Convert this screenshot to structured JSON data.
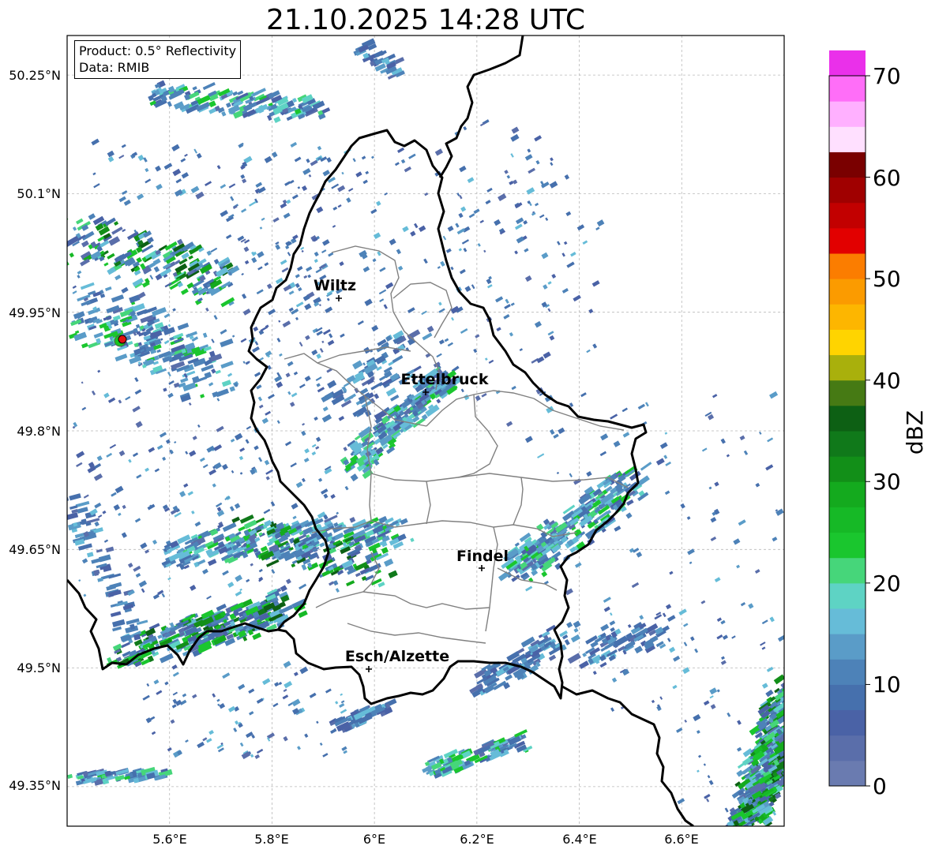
{
  "title": "21.10.2025 14:28 UTC",
  "info_box": {
    "product": "Product: 0.5° Reflectivity",
    "data": "Data: RMIB"
  },
  "axes": {
    "lon_ticks": [
      "5.6°E",
      "5.8°E",
      "6°E",
      "6.2°E",
      "6.4°E",
      "6.6°E"
    ],
    "lat_ticks": [
      "50.25°N",
      "50.1°N",
      "49.95°N",
      "49.8°N",
      "49.65°N",
      "49.5°N",
      "49.35°N"
    ],
    "lon_range": [
      5.4,
      6.8
    ],
    "lat_range": [
      49.3,
      50.3
    ],
    "grid": true
  },
  "cities": [
    {
      "name": "Wiltz",
      "lon": 5.93,
      "lat": 49.967
    },
    {
      "name": "Ettelbruck",
      "lon": 6.1,
      "lat": 49.847
    },
    {
      "name": "Findel",
      "lon": 6.21,
      "lat": 49.627
    },
    {
      "name": "Esch/Alzette",
      "lon": 5.99,
      "lat": 49.5
    }
  ],
  "radar_site": {
    "lon": 5.505,
    "lat": 49.915,
    "color": "#e01010"
  },
  "colorbar": {
    "label": "dBZ",
    "ticks": [
      "0",
      "10",
      "20",
      "30",
      "40",
      "50",
      "60",
      "70"
    ],
    "min": 0,
    "max": 70,
    "step": 2.5,
    "colors": [
      "#6a7bb0",
      "#5a6eaa",
      "#4a62a6",
      "#4670ad",
      "#4d82b8",
      "#5a9cc8",
      "#66bcd8",
      "#5ed3c4",
      "#46d67a",
      "#1ac62e",
      "#16b926",
      "#14aa1e",
      "#128f18",
      "#10791a",
      "#0d6014",
      "#467a14",
      "#a9b00c",
      "#ffd400",
      "#fdb600",
      "#fb9b00",
      "#fb7d00",
      "#e20000",
      "#c20000",
      "#a00000",
      "#7a0000",
      "#ffe0ff",
      "#ffb0ff",
      "#ff6ef8",
      "#ea30ea"
    ]
  }
}
